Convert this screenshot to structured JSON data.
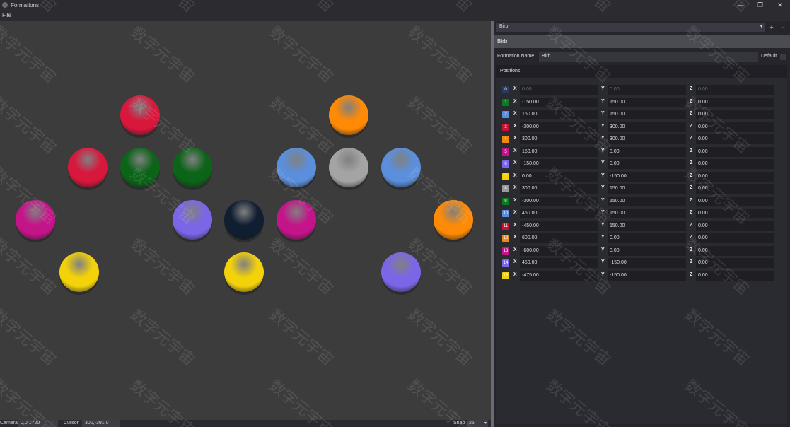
{
  "window": {
    "title": "Formations",
    "minimize": "—",
    "restore": "❐",
    "close": "✕"
  },
  "menu": {
    "file": "File"
  },
  "viewport": {
    "spheres": [
      {
        "color": "#d8173c",
        "col": 0
      },
      {
        "color": "#d8173c",
        "col": 1
      },
      {
        "color": "#0c6418",
        "col": 2
      },
      {
        "color": "#0c6418",
        "col": 3
      },
      {
        "color": "#5b8fdc",
        "col": 4
      },
      {
        "color": "#a4a4a4",
        "col": 5
      },
      {
        "color": "#5b8fdc",
        "col": 6
      },
      {
        "color": "#ff8a06",
        "col": 7
      },
      {
        "color": "#ff8a06",
        "col": 8
      },
      {
        "color": "#c4148a",
        "col": 9
      },
      {
        "color": "#7b66e8",
        "col": 10
      },
      {
        "color": "#0f1e30",
        "col": 11
      },
      {
        "color": "#c4148a",
        "col": 12
      },
      {
        "color": "#f3d20a",
        "col": 13
      },
      {
        "color": "#f3d20a",
        "col": 14
      },
      {
        "color": "#7b66e8",
        "col": 15
      }
    ]
  },
  "status": {
    "camera_label": "Camera",
    "camera_value": "0,0,1720",
    "cursor_label": "Cursor",
    "cursor_value": "300,-391,0",
    "snap_label": "Snap",
    "snap_value": "25",
    "snap_arrow": "▾"
  },
  "panel": {
    "formation_select": "Birb",
    "dropdown_arrow": "▾",
    "add": "+",
    "remove": "−",
    "header": "Birb",
    "name_label": "Formation Name",
    "name_value": "Birb",
    "default_label": "Default",
    "positions_title": "Positions",
    "axis_x": "X",
    "axis_y": "Y",
    "axis_z": "Z",
    "rows": [
      {
        "idx": "0",
        "color": "#2a3c5c",
        "x": "0.00",
        "y": "0.00",
        "z": "0.00"
      },
      {
        "idx": "1",
        "color": "#0c7a1e",
        "x": "-150.00",
        "y": "150.00",
        "z": "0.00"
      },
      {
        "idx": "2",
        "color": "#5b8fdc",
        "x": "150.00",
        "y": "150.00",
        "z": "0.00"
      },
      {
        "idx": "3",
        "color": "#c81434",
        "x": "-300.00",
        "y": "300.00",
        "z": "0.00"
      },
      {
        "idx": "4",
        "color": "#ee8a10",
        "x": "300.00",
        "y": "300.00",
        "z": "0.00"
      },
      {
        "idx": "5",
        "color": "#c4148a",
        "x": "150.00",
        "y": "0.00",
        "z": "0.00"
      },
      {
        "idx": "6",
        "color": "#7b66e8",
        "x": "-150.00",
        "y": "0.00",
        "z": "0.00"
      },
      {
        "idx": "7",
        "color": "#f3d20a",
        "x": "0.00",
        "y": "-150.00",
        "z": "0.00"
      },
      {
        "idx": "8",
        "color": "#9a9a9a",
        "x": "300.00",
        "y": "150.00",
        "z": "0.00"
      },
      {
        "idx": "9",
        "color": "#0c7a1e",
        "x": "-300.00",
        "y": "150.00",
        "z": "0.00"
      },
      {
        "idx": "10",
        "color": "#5b8fdc",
        "x": "450.00",
        "y": "150.00",
        "z": "0.00"
      },
      {
        "idx": "11",
        "color": "#c81434",
        "x": "-450.00",
        "y": "150.00",
        "z": "0.00"
      },
      {
        "idx": "12",
        "color": "#ee8a10",
        "x": "600.00",
        "y": "0.00",
        "z": "0.00"
      },
      {
        "idx": "13",
        "color": "#c4148a",
        "x": "-600.00",
        "y": "0.00",
        "z": "0.00"
      },
      {
        "idx": "14",
        "color": "#7b66e8",
        "x": "450.00",
        "y": "-150.00",
        "z": "0.00"
      },
      {
        "idx": "15",
        "color": "#f3d20a",
        "x": "-475.00",
        "y": "-150.00",
        "z": "0.00"
      }
    ]
  },
  "watermark": "数字元宇宙"
}
